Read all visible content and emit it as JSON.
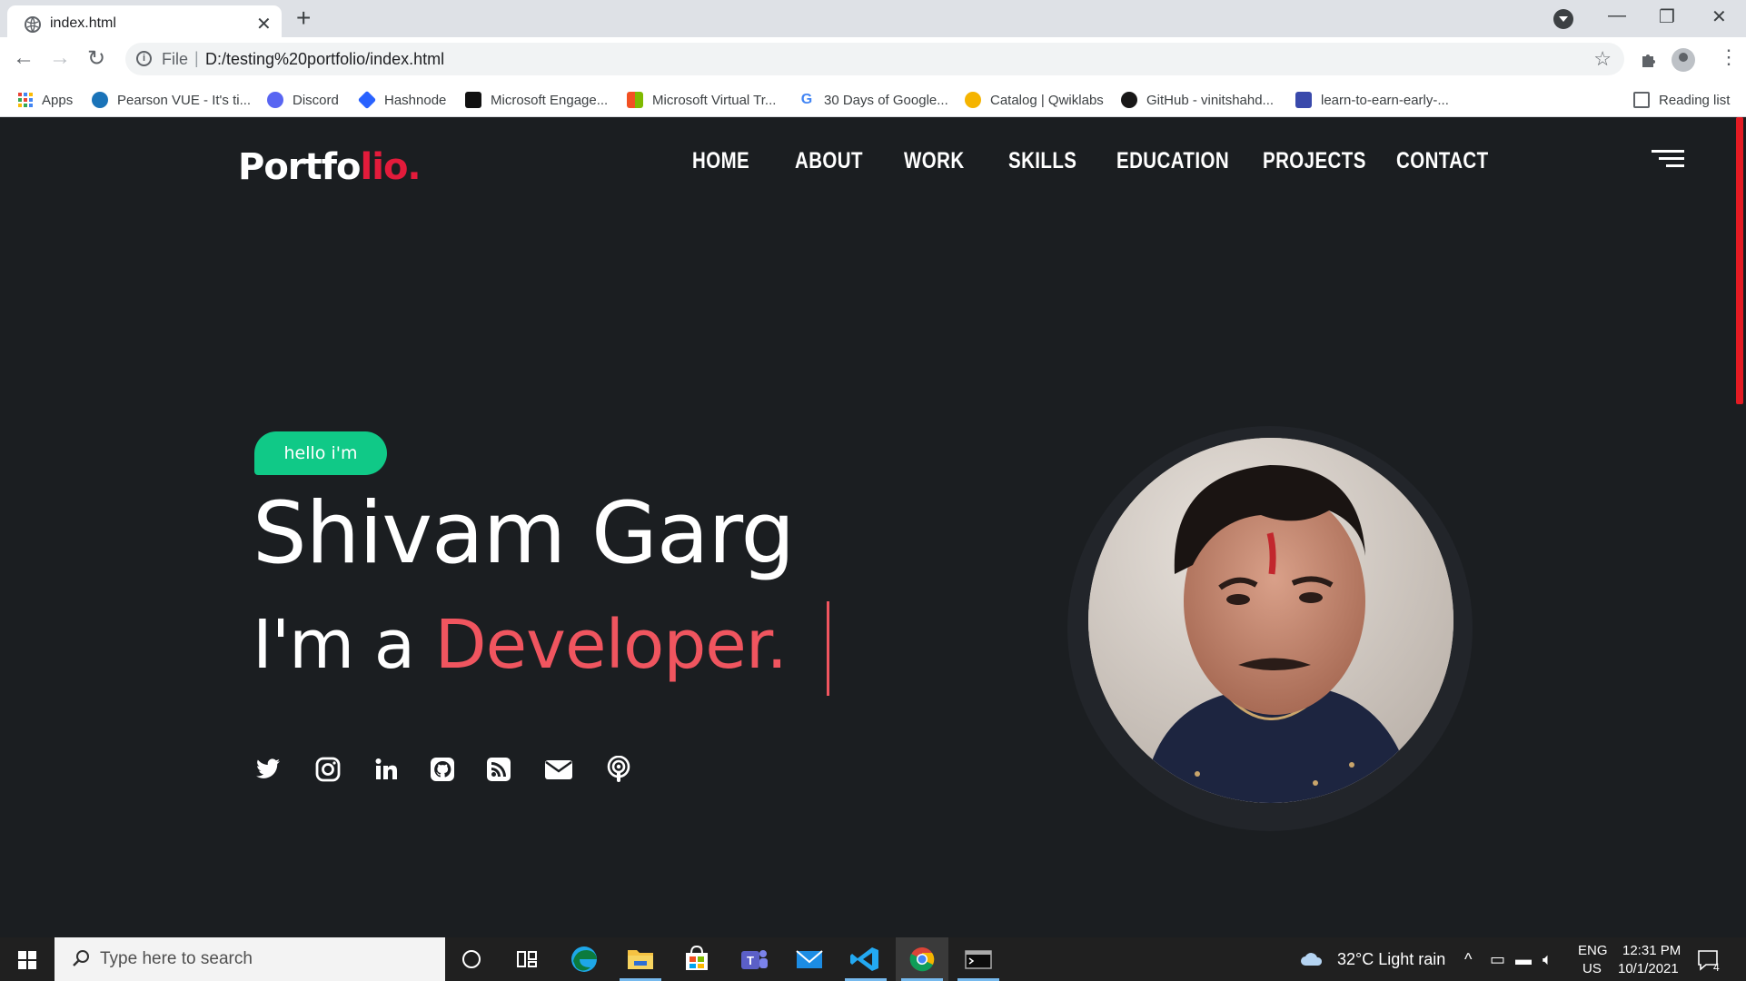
{
  "browser": {
    "tab_title": "index.html",
    "url_scheme": "File",
    "url": "D:/testing%20portfolio/index.html",
    "bookmarks": [
      {
        "label": "Apps",
        "icon": "apps-grid-icon"
      },
      {
        "label": "Pearson VUE - It's ti...",
        "icon": "pearson-icon",
        "color": "#1a73b8"
      },
      {
        "label": "Discord",
        "icon": "discord-icon",
        "color": "#5865f2"
      },
      {
        "label": "Hashnode",
        "icon": "hashnode-icon",
        "color": "#2962ff"
      },
      {
        "label": "Microsoft Engage...",
        "icon": "engage-icon",
        "color": "#111111"
      },
      {
        "label": "Microsoft Virtual Tr...",
        "icon": "microsoft-icon"
      },
      {
        "label": "30 Days of Google...",
        "icon": "google-icon"
      },
      {
        "label": "Catalog | Qwiklabs",
        "icon": "qwiklabs-icon",
        "color": "#f5b400"
      },
      {
        "label": "GitHub - vinitshahd...",
        "icon": "github-icon",
        "color": "#181717"
      },
      {
        "label": "learn-to-earn-early-...",
        "icon": "form-icon",
        "color": "#3949ab"
      }
    ],
    "reading_list": "Reading list"
  },
  "site": {
    "logo_main": "Portfo",
    "logo_accent": "lio.",
    "nav": [
      "HOME",
      "ABOUT",
      "WORK",
      "SKILLS",
      "EDUCATION",
      "PROJECTS",
      "CONTACT"
    ],
    "badge": "hello i'm",
    "name": "Shivam Garg",
    "role_prefix": "I'm a ",
    "role_highlight": "Developer.",
    "socials": [
      "twitter-icon",
      "instagram-icon",
      "linkedin-icon",
      "github-icon",
      "rss-icon",
      "email-icon",
      "podcast-icon"
    ],
    "accent_color": "#f0555f",
    "badge_color": "#10c987"
  },
  "taskbar": {
    "search_placeholder": "Type here to search",
    "weather": "32°C  Light rain",
    "lang_top": "ENG",
    "lang_bottom": "US",
    "time": "12:31 PM",
    "date": "10/1/2021",
    "notifications": "4"
  }
}
